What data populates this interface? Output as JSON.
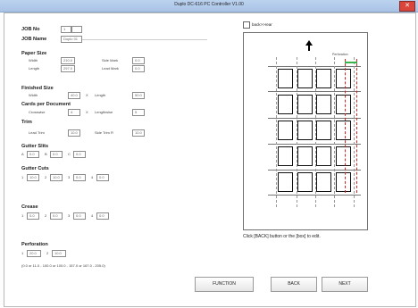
{
  "window": {
    "title": "Duplo DC-616 PC Controller V1.00",
    "close_glyph": "✕"
  },
  "job": {
    "no_label": "JOB No",
    "no_value": "1",
    "name_label": "JOB Name",
    "name_value": "Duplo 01"
  },
  "paper": {
    "header": "Paper Size",
    "width_label": "Width",
    "width_value": "210.0",
    "length_label": "Length",
    "length_value": "297.0",
    "side_mark_label": "Side Mark",
    "side_mark_value": "0.0",
    "lead_mark_label": "Lead Mark",
    "lead_mark_value": "0.0"
  },
  "finished": {
    "header": "Finished Size",
    "width_label": "Width",
    "width_value": "40.0",
    "x": "X",
    "length_label": "Length",
    "length_value": "50.0"
  },
  "cards": {
    "header": "Cards per Document",
    "crosswise_label": "Crosswise",
    "crosswise_value": "4",
    "x": "X",
    "lengthwise_label": "Lengthwise",
    "lengthwise_value": "5"
  },
  "trim": {
    "header": "Trim",
    "lead_label": "Lead Trim",
    "lead_value": "10.0",
    "side_label": "Side Trim R",
    "side_value": "10.0"
  },
  "gutter_slits": {
    "header": "Gutter Slits",
    "n1": "A",
    "v1": "0.0",
    "n2": "B",
    "v2": "0.0",
    "n3": "C",
    "v3": "0.0"
  },
  "gutter_cuts": {
    "header": "Gutter Cuts",
    "n1": "1",
    "v1": "10.0",
    "n2": "2",
    "v2": "10.0",
    "n3": "3",
    "v3": "0.0",
    "n4": "4",
    "v4": "0.0"
  },
  "crease": {
    "header": "Crease",
    "n1": "1",
    "v1": "0.0",
    "n2": "2",
    "v2": "0.0",
    "n3": "3",
    "v3": "0.0",
    "n4": "4",
    "v4": "0.0"
  },
  "perforation": {
    "header": "Perforation",
    "n1": "1",
    "v1": "20.0",
    "n2": "2",
    "v2": "10.0",
    "range": "(0.0 or 11.0 - 100.0 or 100.0 - 157.0 or 167.0 - 205.0)"
  },
  "preview": {
    "checkbox_label": "back>>rear",
    "perforation_label": "Perforation",
    "hint": "Click [BACK] button or the [box] to edit."
  },
  "buttons": {
    "function": "FUNCTION",
    "back": "BACK",
    "next": "NEXT"
  }
}
